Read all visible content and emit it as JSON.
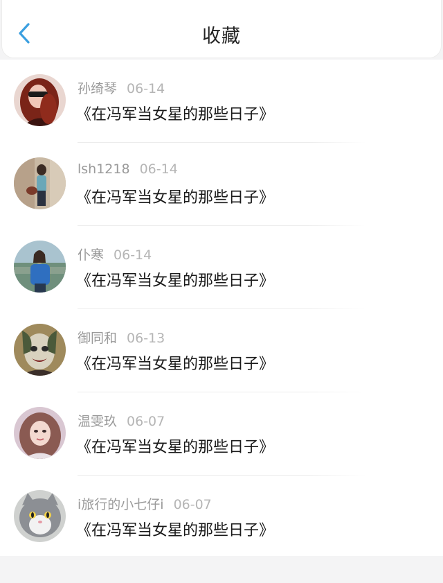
{
  "header": {
    "title": "收藏",
    "back_icon": "chevron-left-icon",
    "accent_color": "#3a9fe0"
  },
  "favorites": [
    {
      "user": "孙绮琴",
      "date": "06-14",
      "title": "《在冯军当女星的那些日子》"
    },
    {
      "user": "lsh1218",
      "date": "06-14",
      "title": "《在冯军当女星的那些日子》"
    },
    {
      "user": "仆寒",
      "date": "06-14",
      "title": "《在冯军当女星的那些日子》"
    },
    {
      "user": "御同和",
      "date": "06-13",
      "title": "《在冯军当女星的那些日子》"
    },
    {
      "user": "温雯玖",
      "date": "06-07",
      "title": "《在冯军当女星的那些日子》"
    },
    {
      "user": "i旅行的小七仔i",
      "date": "06-07",
      "title": "《在冯军当女星的那些日子》"
    }
  ]
}
